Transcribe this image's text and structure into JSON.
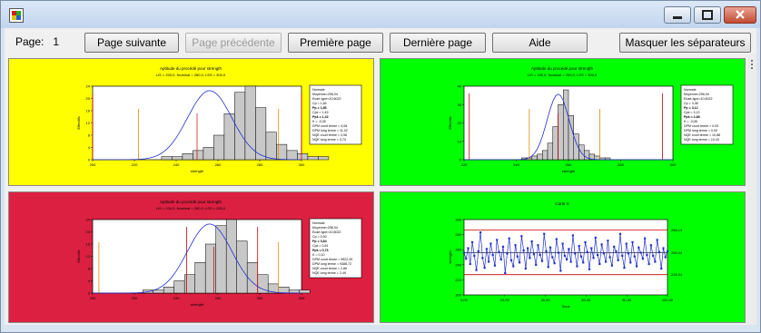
{
  "window": {
    "icon_name": "app-icon"
  },
  "toolbar": {
    "page_label": "Page:",
    "page_number": "1",
    "buttons": [
      {
        "label": "Page suivante",
        "enabled": true
      },
      {
        "label": "Page précédente",
        "enabled": false
      },
      {
        "label": "Première page",
        "enabled": true
      },
      {
        "label": "Dernière page",
        "enabled": true
      },
      {
        "label": "Aide",
        "enabled": true
      },
      {
        "label": "Masquer les séparateurs",
        "enabled": true
      }
    ]
  },
  "panes": [
    {
      "background": "#ffff00",
      "chart": {
        "type": "bar",
        "title": "Aptitude du procédé pour strength",
        "subtitle": "LIS = 200,0, Nominal = 280,0, LSS = 300,0",
        "xlabel": "strength",
        "ylabel": "Effectifs",
        "xlim": [
          200,
          300
        ],
        "ylim": [
          0,
          24
        ],
        "xticks": [
          "200",
          "220",
          "240",
          "260",
          "280",
          "300"
        ],
        "yticks": [
          "0",
          "4",
          "8",
          "12",
          "16",
          "20",
          "24"
        ],
        "bin_start": 233,
        "bin_width": 5,
        "values": [
          1,
          1,
          2,
          3,
          4,
          8,
          15,
          22,
          24,
          17,
          9,
          5,
          3,
          2,
          1,
          1
        ],
        "mean": 256.04,
        "sd": 10.6,
        "spec_lines": [
          200,
          300
        ],
        "limit_lines": [
          222,
          289
        ],
        "center_line": 250,
        "stats": [
          "Normale",
          "Moyenne=256,04",
          "Ecart-type=10,6022",
          "Cp = 1,84",
          "Pp = 1,86",
          "Cpk = 1,49",
          "Ppk = 1,42",
          "K = -0,28",
          "DPM court terme = 4,08",
          "DPM long terme = 11,02",
          "NQE court terme = 3,96",
          "NQE long terme = 3,74"
        ]
      }
    },
    {
      "background": "#00ff00",
      "chart": {
        "type": "bar",
        "title": "Aptitude du procédé pour strength",
        "subtitle": "LIS = 180,0, Nominal = 260,0, LSS = 300,0",
        "xlabel": "strength",
        "ylabel": "Effectifs",
        "xlim": [
          220,
          300
        ],
        "ylim": [
          0,
          40
        ],
        "xticks": [
          "220",
          "240",
          "260",
          "280",
          "300"
        ],
        "yticks": [
          "0",
          "10",
          "20",
          "30",
          "40"
        ],
        "bin_start": 242,
        "bin_width": 2,
        "values": [
          1,
          1,
          2,
          3,
          5,
          9,
          18,
          30,
          38,
          24,
          14,
          8,
          5,
          3,
          2,
          1,
          1
        ],
        "mean": 256.04,
        "sd": 4.2,
        "spec_lines": [
          222,
          296
        ],
        "limit_lines": [
          245,
          272
        ],
        "center_line": 256,
        "stats": [
          "Normale",
          "Moyenne=256,04",
          "Ecart-type=10,6022",
          "Cp = 3,38",
          "Pp = 3,12",
          "Cpk = 3,13",
          "Ppk = 2,88",
          "K = -0,08",
          "DPM court terme = 0,00",
          "DPM long terme = 0,00",
          "NQE court terme = 10,88",
          "NQE long terme = 10,43"
        ]
      }
    },
    {
      "background": "#dc2041",
      "chart": {
        "type": "bar",
        "title": "Aptitude du procédé pour strength",
        "subtitle": "LIS = 200,0, Nominal = 260,0, LSS = 280,0",
        "xlabel": "strength",
        "ylabel": "Effectifs",
        "xlim": [
          200,
          300
        ],
        "ylim": [
          0,
          24
        ],
        "xticks": [
          "200",
          "220",
          "240",
          "260",
          "280",
          "300"
        ],
        "yticks": [
          "0",
          "4",
          "8",
          "12",
          "16",
          "20",
          "24"
        ],
        "bin_start": 224,
        "bin_width": 5,
        "values": [
          1,
          1,
          2,
          4,
          6,
          10,
          16,
          22,
          24,
          17,
          10,
          6,
          3,
          2,
          1,
          1
        ],
        "mean": 256.04,
        "sd": 10.6,
        "spec_lines": [
          245,
          279
        ],
        "limit_lines": [
          203,
          289
        ],
        "center_line": 258,
        "stats": [
          "Normale",
          "Moyenne=256,04",
          "Ecart-type=10,6022",
          "Cp = 0,90",
          "Pp = 0,84",
          "Cpk = 0,81",
          "Ppk = 0,76",
          "K = 0,10",
          "DPM court terme = 9522,39",
          "DPM long terme = 9388,72",
          "NQE court terme = 2,86",
          "NQE long terme = 2,49"
        ]
      }
    },
    {
      "background": "#00ff00",
      "chart": {
        "type": "line",
        "title": "Carte X",
        "xlabel": "Sous",
        "ylabel": "strength",
        "xlim": [
          0,
          100
        ],
        "ylim": [
          200,
          300
        ],
        "xticks": [
          "0,00",
          "20,00",
          "40,00",
          "60,00",
          "80,00",
          "100,00"
        ],
        "yticks": [
          "200",
          "220",
          "240",
          "260",
          "280",
          "300"
        ],
        "center": 256.04,
        "ucl": 286.13,
        "lcl": 226.91,
        "right_labels": [
          "286,13",
          "256,04",
          "226,91"
        ],
        "values": [
          256,
          248,
          262,
          241,
          270,
          252,
          233,
          258,
          283,
          249,
          236,
          261,
          244,
          268,
          253,
          239,
          273,
          257,
          247,
          264,
          229,
          255,
          275,
          246,
          238,
          266,
          251,
          243,
          278,
          259,
          235,
          262,
          249,
          271,
          254,
          240,
          266,
          253,
          245,
          281,
          258,
          237,
          263,
          250,
          242,
          274,
          256,
          232,
          268,
          252,
          247,
          261,
          244,
          279,
          255,
          238,
          265,
          251,
          243,
          270,
          257,
          234,
          262,
          249,
          276,
          253,
          241,
          267,
          255,
          244,
          272,
          250,
          239,
          264,
          258,
          246,
          281,
          252,
          236,
          268,
          255,
          243,
          270,
          251,
          238,
          263,
          256,
          248,
          275,
          253,
          241,
          266,
          252,
          244,
          273,
          257,
          235,
          262,
          250,
          258
        ]
      }
    }
  ]
}
